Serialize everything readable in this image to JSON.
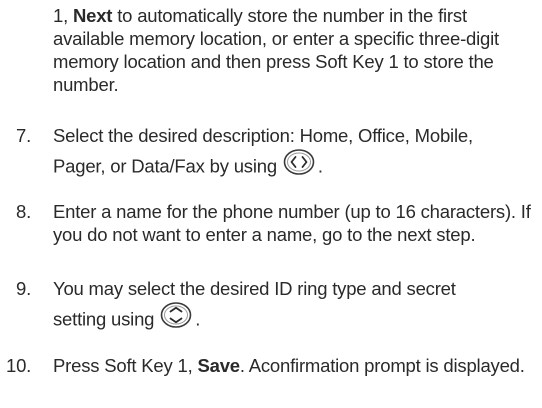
{
  "continuation": {
    "a": "1, ",
    "b": "Next",
    "c": " to automatically store the number in the first available memory location, or enter a specific three-digit memory location and then press Soft Key 1 to store the number."
  },
  "steps": [
    {
      "number": "7.",
      "line1": "Select the desired description: Home, Office, Mobile,",
      "line2": "Pager, or Data/Fax by using",
      "icon": "left-right-navigation-key-icon",
      "after": "."
    },
    {
      "number": "8.",
      "text": "Enter a name for the phone number (up to 16 characters). If you do not want to enter a name, go to the next step."
    },
    {
      "number": "9.",
      "line1": "You may select the desired ID ring type and secret",
      "line2": "setting using",
      "icon": "up-down-navigation-key-icon",
      "after": "."
    },
    {
      "number": "10.",
      "a": "Press Soft Key 1, ",
      "b": "Save",
      "c": ". Aconfirmation prompt is displayed."
    }
  ]
}
